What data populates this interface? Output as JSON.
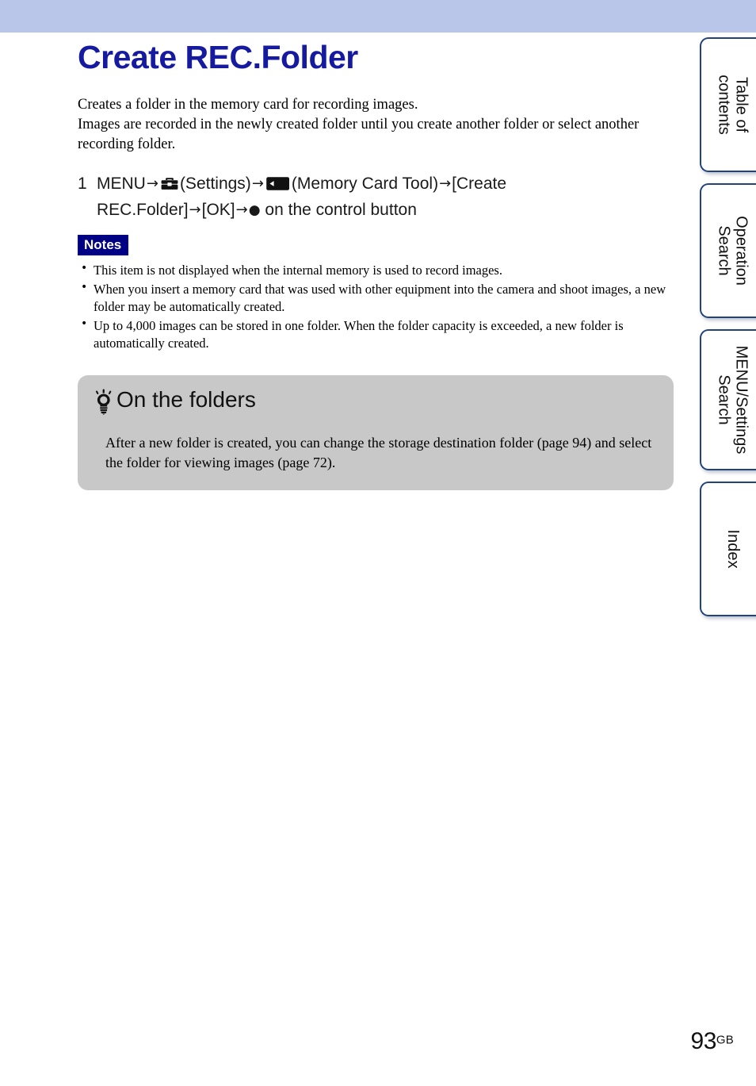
{
  "header": {
    "banner_color": "#b9c6ea"
  },
  "title": "Create REC.Folder",
  "title_color": "#161a9e",
  "intro": {
    "line1": "Creates a folder in the memory card for recording images.",
    "line2": "Images are recorded in the newly created folder until you create another folder or select another recording folder."
  },
  "step": {
    "number": "1",
    "part1": "MENU",
    "arrow1": "→",
    "icon1_name": "settings-toolbox-icon",
    "part2": "(Settings)",
    "arrow2": "→",
    "icon2_name": "memory-card-icon",
    "part3": "(Memory Card Tool)",
    "arrow3": "→",
    "part4": "[Create REC.Folder]",
    "arrow4": "→",
    "part5": "[OK]",
    "arrow5": "→",
    "dot": "●",
    "part6": "on the control button"
  },
  "notes": {
    "badge": "Notes",
    "badge_bg": "#010184",
    "bullet": "•",
    "items": [
      "This item is not displayed when the internal memory is used to record images.",
      "When you insert a memory card that was used with other equipment into the camera and shoot images, a new folder may be automatically created.",
      "Up to 4,000 images can be stored in one folder. When the folder capacity is exceeded, a new folder is automatically created."
    ]
  },
  "tip": {
    "icon_name": "lightbulb-icon",
    "heading": "On the folders",
    "body": "After a new folder is created, you can change the storage destination folder (page 94) and select the folder for viewing images (page 72).",
    "bg_color": "#c8c8c8"
  },
  "tabs": [
    {
      "label": "Table of contents"
    },
    {
      "label": "Operation Search"
    },
    {
      "label": "MENU/Settings Search"
    },
    {
      "label": "Index"
    }
  ],
  "footer": {
    "page_number": "93",
    "page_suffix": "GB"
  }
}
